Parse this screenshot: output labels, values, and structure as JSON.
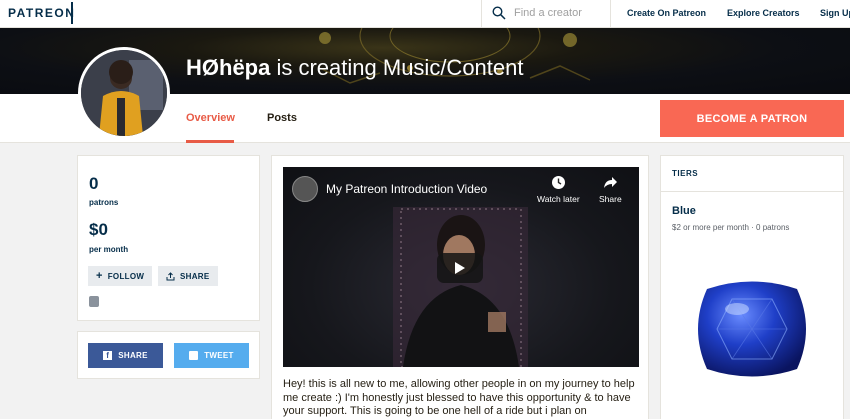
{
  "nav": {
    "logo": "PATREON",
    "search_placeholder": "Find a creator",
    "links": [
      "Create On Patreon",
      "Explore Creators",
      "Sign Up"
    ]
  },
  "creator": {
    "name": "HØhëpa",
    "tagline": "is creating Music/Content"
  },
  "tabs": [
    "Overview",
    "Posts"
  ],
  "cta": "BECOME A PATRON",
  "stats": {
    "patrons_value": "0",
    "patrons_label": "patrons",
    "amount_value": "$0",
    "amount_label": "per month",
    "follow_label": "FOLLOW",
    "share_label": "SHARE"
  },
  "social": {
    "facebook_label": "SHARE",
    "twitter_label": "TWEET"
  },
  "video": {
    "title": "My Patreon Introduction Video",
    "watch_later": "Watch later",
    "share": "Share"
  },
  "description": "Hey! this is all new to me, allowing other people in on my journey to help me create :) I'm honestly just blessed to have this opportunity & to have your support. This is going to be one hell of a ride but i plan on",
  "tiers": {
    "heading": "TIERS",
    "items": [
      {
        "name": "Blue",
        "subtitle": "$2 or more per month · 0 patrons"
      }
    ]
  },
  "colors": {
    "accent": "#f96854",
    "navy": "#052d49",
    "facebook": "#3b5998",
    "twitter": "#55acee"
  }
}
